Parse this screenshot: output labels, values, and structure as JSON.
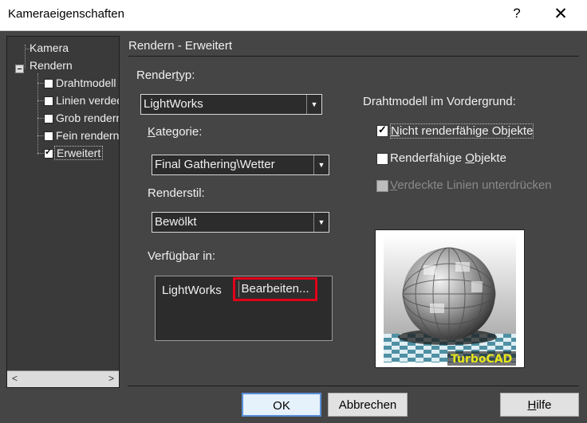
{
  "window": {
    "title": "Kameraeigenschaften",
    "help_glyph": "?",
    "close_glyph": "✕"
  },
  "tree": {
    "items": [
      {
        "label": "Kamera",
        "level": 0
      },
      {
        "label": "Rendern",
        "level": 0,
        "expanded": true
      },
      {
        "label": "Drahtmodell",
        "level": 1,
        "checked": false
      },
      {
        "label": "Linien verdeckt",
        "level": 1,
        "checked": false
      },
      {
        "label": "Grob rendern",
        "level": 1,
        "checked": false
      },
      {
        "label": "Fein rendern",
        "level": 1,
        "checked": false
      },
      {
        "label": "Erweitert",
        "level": 1,
        "checked": true,
        "selected": true
      }
    ],
    "scroll_left": "<",
    "scroll_right": ">"
  },
  "section": {
    "title": "Rendern - Erweitert"
  },
  "rendertyp": {
    "label_pre": "Render",
    "label_u": "t",
    "label_post": "yp:",
    "value": "LightWorks"
  },
  "kategorie": {
    "label_u": "K",
    "label_post": "ategorie:",
    "value": "Final Gathering\\Wetter"
  },
  "renderstil": {
    "label": "Renderstil:",
    "value": "Bewölkt"
  },
  "available": {
    "label": "Verfügbar in:",
    "app": "LightWorks",
    "edit_button": "Bearbeiten..."
  },
  "foreground": {
    "label": "Drahtmodell im Vordergrund:",
    "options": [
      {
        "pre": "",
        "u": "N",
        "post": "icht renderfähige Objekte",
        "checked": true,
        "disabled": false
      },
      {
        "pre": "Renderfähige ",
        "u": "O",
        "post": "bjekte",
        "checked": false,
        "disabled": false
      },
      {
        "pre": "",
        "u": "V",
        "post": "erdeckte Linien unterdrücken",
        "checked": false,
        "disabled": true
      }
    ]
  },
  "preview": {
    "watermark": "TurboCAD"
  },
  "buttons": {
    "ok": "OK",
    "cancel": "Abbrechen",
    "help": "Hilfe",
    "help_u": "H",
    "help_post": "ilfe"
  },
  "colors": {
    "background": "#454545",
    "field": "#2c2c2c",
    "highlight": "#e2001a",
    "watermark": "#e7e61a"
  }
}
